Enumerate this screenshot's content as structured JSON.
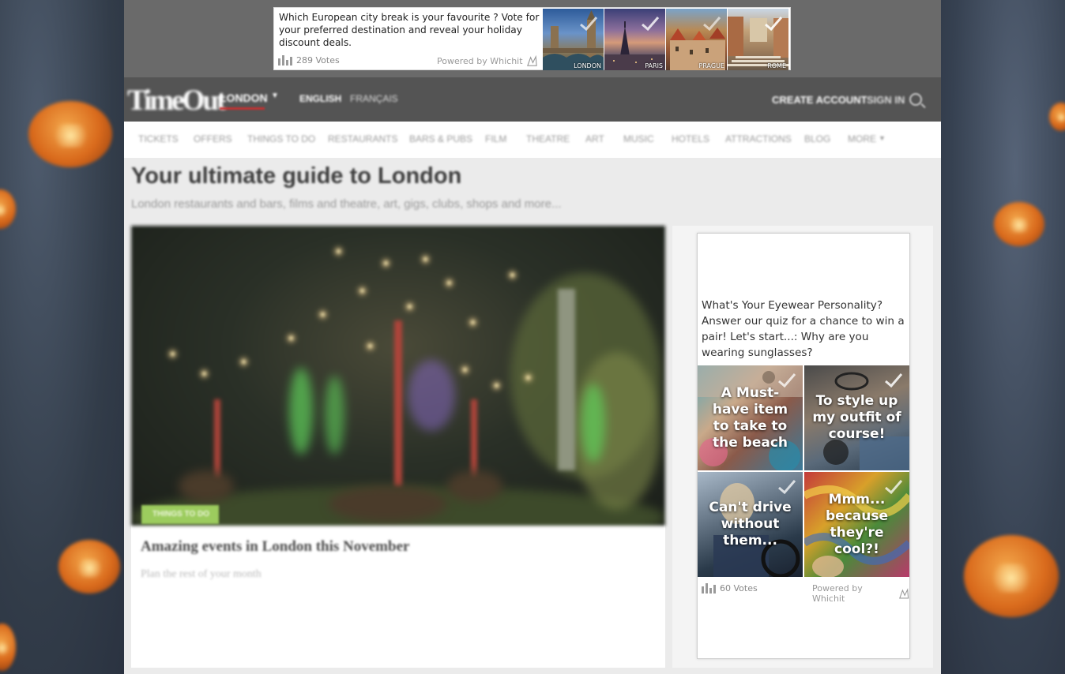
{
  "top_poll": {
    "question": "Which European city break is your favourite ? Vote for your preferred destination and reveal your holiday discount deals.",
    "votes": "289 Votes",
    "powered_by": "Powered by Whichit",
    "options": [
      {
        "label": "LONDON"
      },
      {
        "label": "PARIS"
      },
      {
        "label": "PRAGUE"
      },
      {
        "label": "ROME"
      }
    ]
  },
  "site": {
    "logo": "TimeOut",
    "city": "LONDON",
    "languages": [
      "ENGLISH",
      "FRANÇAIS"
    ],
    "create_account": "CREATE ACCOUNT",
    "sign_in": "SIGN IN",
    "nav": [
      "TICKETS",
      "OFFERS",
      "THINGS TO DO",
      "RESTAURANTS",
      "BARS & PUBS",
      "FILM",
      "THEATRE",
      "ART",
      "MUSIC",
      "HOTELS",
      "ATTRACTIONS",
      "BLOG",
      "MORE"
    ],
    "headline": "Your ultimate guide to London",
    "subhead": "London restaurants and bars, films and theatre, art, gigs, clubs, shops and more...",
    "feature": {
      "tag": "THINGS TO DO",
      "title": "Amazing events in London this November",
      "subtitle": "Plan the rest of your month"
    }
  },
  "side_poll": {
    "question": "What's Your Eyewear Personality? Answer our quiz for a chance to win a pair! Let's start...: Why are you wearing sunglasses?",
    "answers": [
      "A Must-have item to take to the beach",
      "To style up my outfit of course!",
      "Can't drive without them...",
      "Mmm... because they're cool?!"
    ],
    "votes": "60 Votes",
    "powered_by": "Powered by Whichit"
  },
  "colors": {
    "timeout_red": "#c43030",
    "tag_green": "#9ccc5e"
  }
}
